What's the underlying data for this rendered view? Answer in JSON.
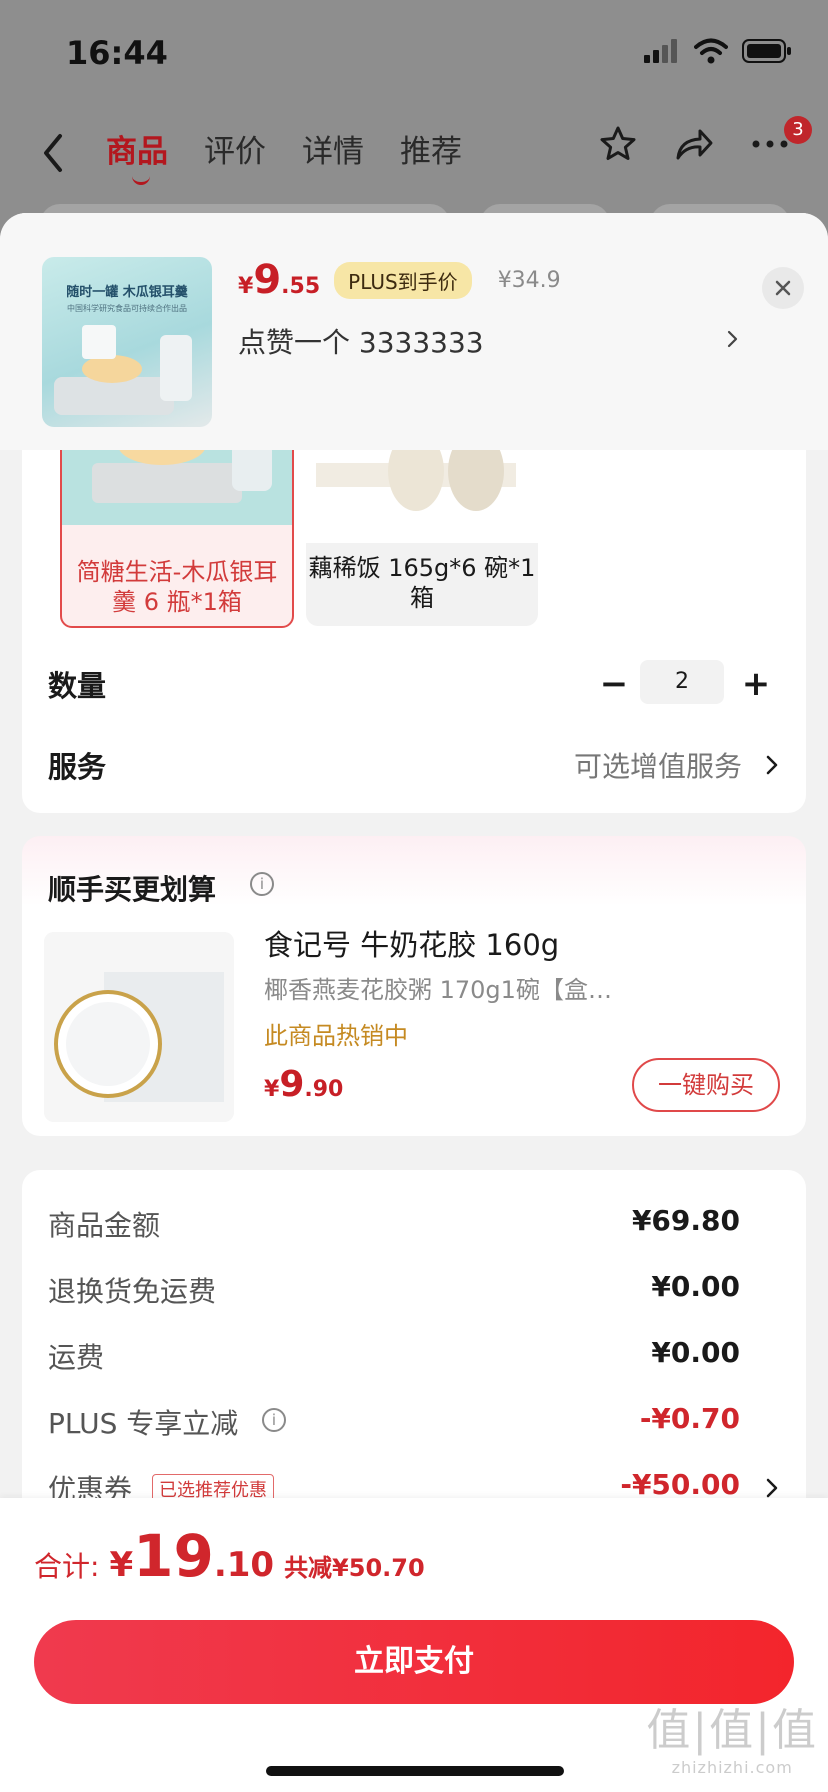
{
  "status_bar": {
    "time": "16:44"
  },
  "nav": {
    "tabs": [
      {
        "label": "商品"
      },
      {
        "label": "评价"
      },
      {
        "label": "详情"
      },
      {
        "label": "推荐"
      }
    ],
    "badge_count": "3"
  },
  "product": {
    "thumb_title": "随时一罐 木瓜银耳羹",
    "thumb_sub": "中国科学研究食品可持续合作出品",
    "price_yen": "¥",
    "price_int": "9",
    "price_dec": ".55",
    "plus_label": "PLUS到手价",
    "original_price": "¥34.9",
    "like_text": "点赞一个  3333333"
  },
  "sku": {
    "options": [
      {
        "label_line1": "简糖生活-木瓜银耳",
        "label_line2": "羹 6 瓶*1箱"
      },
      {
        "label_line1": "藕稀饭 165g*6 碗*1",
        "label_line2": "箱"
      }
    ],
    "quantity_label": "数量",
    "quantity": "2",
    "service_label": "服务",
    "service_value": "可选增值服务"
  },
  "bundle": {
    "title": "顺手买更划算",
    "name": "食记号 牛奶花胶 160g",
    "sub": "椰香燕麦花胶粥 170g1碗【盒…",
    "hot": "此商品热销中",
    "price_yen": "¥",
    "price_int": "9",
    "price_dec": ".90",
    "buy_label": "一键购买"
  },
  "summary": {
    "rows": [
      {
        "label": "商品金额",
        "value": "¥69.80"
      },
      {
        "label": "退换货免运费",
        "value": "¥0.00"
      },
      {
        "label": "运费",
        "value": "¥0.00"
      },
      {
        "label": "PLUS 专享立减",
        "value": "-¥0.70"
      },
      {
        "label": "优惠券",
        "value": "-¥50.00",
        "tag": "已选推荐优惠"
      }
    ]
  },
  "footer": {
    "total_label": "合计:",
    "total_yen": "¥",
    "total_int": "19",
    "total_dec": ".10",
    "saved": "共减¥50.70",
    "pay_label": "立即支付"
  },
  "watermark": {
    "main": "值|值|值",
    "sub": "zhizhizhi.com"
  },
  "colors": {
    "accent": "#c71f26",
    "plus_badge": "#f7e6a6",
    "pay_button": "#f3252c"
  }
}
